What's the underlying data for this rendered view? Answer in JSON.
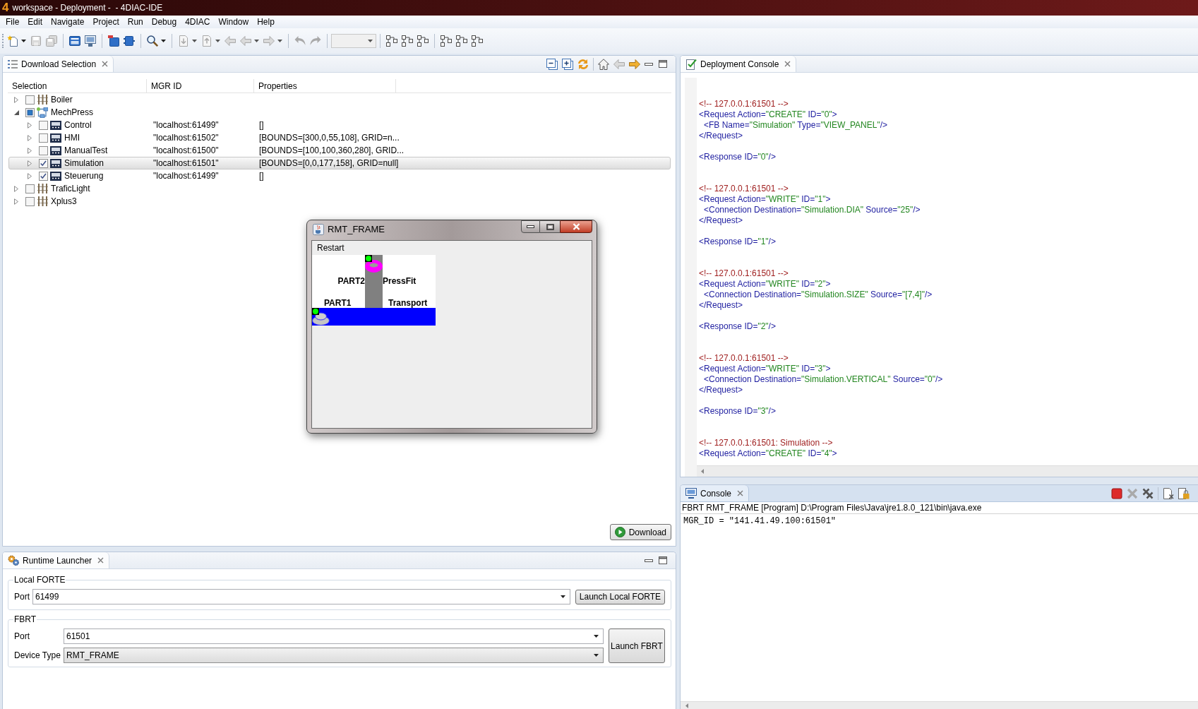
{
  "window": {
    "app_icon": "4",
    "title": "workspace - Deployment -  - 4DIAC-IDE"
  },
  "menu": [
    {
      "label": "File"
    },
    {
      "label": "Edit"
    },
    {
      "label": "Navigate"
    },
    {
      "label": "Project"
    },
    {
      "label": "Run"
    },
    {
      "label": "Debug"
    },
    {
      "label": "4DIAC"
    },
    {
      "label": "Window"
    },
    {
      "label": "Help"
    }
  ],
  "toolbar": {
    "groups": [
      [
        {
          "kind": "new",
          "disabled": false,
          "dropdown": true
        },
        {
          "kind": "save",
          "disabled": true,
          "dropdown": false
        },
        {
          "kind": "saveall",
          "disabled": true,
          "dropdown": false
        }
      ],
      [
        {
          "kind": "window",
          "disabled": false,
          "dropdown": false
        },
        {
          "kind": "monitor",
          "disabled": false,
          "dropdown": false
        }
      ],
      [
        {
          "kind": "blockmark",
          "disabled": false,
          "dropdown": false
        },
        {
          "kind": "block",
          "disabled": false,
          "dropdown": false
        }
      ],
      [
        {
          "kind": "search",
          "disabled": false,
          "dropdown": true
        }
      ],
      [
        {
          "kind": "pagedown",
          "disabled": true,
          "dropdown": true
        },
        {
          "kind": "pageup",
          "disabled": true,
          "dropdown": true
        },
        {
          "kind": "lastedit",
          "disabled": true,
          "dropdown": false
        },
        {
          "kind": "back",
          "disabled": true,
          "dropdown": true
        },
        {
          "kind": "forward",
          "disabled": true,
          "dropdown": true
        }
      ],
      [
        {
          "kind": "undo",
          "disabled": true,
          "dropdown": false
        },
        {
          "kind": "redo",
          "disabled": true,
          "dropdown": false
        }
      ],
      [
        {
          "kind": "combo",
          "disabled": true,
          "dropdown": true
        }
      ],
      [
        {
          "kind": "nodes",
          "disabled": false,
          "dropdown": false
        },
        {
          "kind": "nodes",
          "disabled": false,
          "dropdown": false
        },
        {
          "kind": "nodes",
          "disabled": false,
          "dropdown": false
        }
      ],
      [
        {
          "kind": "nodes",
          "disabled": false,
          "dropdown": false
        },
        {
          "kind": "nodes",
          "disabled": false,
          "dropdown": false
        },
        {
          "kind": "nodes",
          "disabled": false,
          "dropdown": false
        }
      ]
    ]
  },
  "download_selection": {
    "tab": {
      "label": "Download Selection",
      "active": false
    },
    "tools": [
      [
        {
          "kind": "collapseall",
          "disabled": false
        },
        {
          "kind": "expandall",
          "disabled": false
        },
        {
          "kind": "sync",
          "disabled": false
        }
      ],
      [
        {
          "kind": "home",
          "disabled": false
        },
        {
          "kind": "back",
          "disabled": true
        },
        {
          "kind": "forward",
          "disabled": false
        }
      ]
    ],
    "columns": [
      {
        "label": "Selection"
      },
      {
        "label": "MGR ID"
      },
      {
        "label": "Properties"
      }
    ],
    "items": [
      {
        "label": "Boiler",
        "kind": "system",
        "expanded": false,
        "checked": false,
        "partial": false,
        "selected": false
      },
      {
        "label": "MechPress",
        "kind": "system",
        "expanded": true,
        "checked": false,
        "partial": true,
        "selected": false,
        "children": [
          {
            "label": "Control",
            "kind": "device",
            "mgr_id": "\"localhost:61499\"",
            "properties": "[]",
            "expanded": false,
            "checked": false,
            "partial": false,
            "selected": false
          },
          {
            "label": "HMI",
            "kind": "device",
            "mgr_id": "\"localhost:61502\"",
            "properties": "[BOUNDS=[300,0,55,108], GRID=n...",
            "expanded": false,
            "checked": false,
            "partial": false,
            "selected": false
          },
          {
            "label": "ManualTest",
            "kind": "device",
            "mgr_id": "\"localhost:61500\"",
            "properties": "[BOUNDS=[100,100,360,280], GRID...",
            "expanded": false,
            "checked": false,
            "partial": false,
            "selected": false
          },
          {
            "label": "Simulation",
            "kind": "device",
            "mgr_id": "\"localhost:61501\"",
            "properties": "[BOUNDS=[0,0,177,158], GRID=null]",
            "expanded": false,
            "checked": true,
            "partial": false,
            "selected": true
          },
          {
            "label": "Steuerung",
            "kind": "device",
            "mgr_id": "\"localhost:61499\"",
            "properties": "[]",
            "expanded": false,
            "checked": true,
            "partial": false,
            "selected": false
          }
        ]
      },
      {
        "label": "TraficLight",
        "kind": "system",
        "expanded": false,
        "checked": false,
        "partial": false,
        "selected": false
      },
      {
        "label": "Xplus3",
        "kind": "system",
        "expanded": false,
        "checked": false,
        "partial": false,
        "selected": false
      }
    ],
    "download_button": {
      "label": "Download"
    }
  },
  "rmt_frame": {
    "title": "RMT_FRAME",
    "menu": [
      {
        "label": "Restart"
      }
    ],
    "simulation": {
      "upper_part_label": "PART2",
      "press_label": "PressFit",
      "lower_part_label": "PART1",
      "conveyor_label": "Transport",
      "sensors": [
        {
          "on": true
        },
        {
          "on": true
        }
      ]
    }
  },
  "runtime_launcher": {
    "tab": {
      "label": "Runtime Launcher",
      "active": false
    },
    "local_forte": {
      "title": "Local FORTE",
      "port": {
        "label": "Port",
        "value": "61499",
        "readonly": false
      },
      "launch_button": "Launch Local FORTE"
    },
    "fbrt": {
      "title": "FBRT",
      "port": {
        "label": "Port",
        "value": "61501",
        "readonly": false
      },
      "device_type": {
        "label": "Device Type",
        "value": "RMT_FRAME",
        "readonly": true
      },
      "launch_button": "Launch FBRT"
    }
  },
  "deployment_console": {
    "tab": {
      "label": "Deployment Console",
      "active": false
    },
    "entries": [
      {
        "comment": [
          {
            "kind": "comment",
            "text": "<!-- 127.0.0.1:61501 -->"
          }
        ],
        "request": {
          "open": [
            {
              "kind": "tag",
              "text": "<Request Action="
            },
            {
              "kind": "value",
              "text": "\"CREATE\""
            },
            {
              "kind": "tag",
              "text": " ID="
            },
            {
              "kind": "value",
              "text": "\"0\""
            },
            {
              "kind": "tag",
              "text": ">"
            }
          ],
          "children": [
            [
              {
                "kind": "tag",
                "text": "<FB Name="
              },
              {
                "kind": "value",
                "text": "\"Simulation\""
              },
              {
                "kind": "tag",
                "text": " Type="
              },
              {
                "kind": "value",
                "text": "\"VIEW_PANEL\""
              },
              {
                "kind": "tag",
                "text": "/>"
              }
            ]
          ],
          "close": [
            {
              "kind": "tag",
              "text": "</Request>"
            }
          ]
        },
        "response": [
          {
            "kind": "tag",
            "text": "<Response ID="
          },
          {
            "kind": "value",
            "text": "\"0\""
          },
          {
            "kind": "tag",
            "text": "/>"
          }
        ]
      },
      {
        "comment": [
          {
            "kind": "comment",
            "text": "<!-- 127.0.0.1:61501 -->"
          }
        ],
        "request": {
          "open": [
            {
              "kind": "tag",
              "text": "<Request Action="
            },
            {
              "kind": "value",
              "text": "\"WRITE\""
            },
            {
              "kind": "tag",
              "text": " ID="
            },
            {
              "kind": "value",
              "text": "\"1\""
            },
            {
              "kind": "tag",
              "text": ">"
            }
          ],
          "children": [
            [
              {
                "kind": "tag",
                "text": "<Connection Destination="
              },
              {
                "kind": "value",
                "text": "\"Simulation.DIA\""
              },
              {
                "kind": "tag",
                "text": " Source="
              },
              {
                "kind": "value",
                "text": "\"25\""
              },
              {
                "kind": "tag",
                "text": "/>"
              }
            ]
          ],
          "close": [
            {
              "kind": "tag",
              "text": "</Request>"
            }
          ]
        },
        "response": [
          {
            "kind": "tag",
            "text": "<Response ID="
          },
          {
            "kind": "value",
            "text": "\"1\""
          },
          {
            "kind": "tag",
            "text": "/>"
          }
        ]
      },
      {
        "comment": [
          {
            "kind": "comment",
            "text": "<!-- 127.0.0.1:61501 -->"
          }
        ],
        "request": {
          "open": [
            {
              "kind": "tag",
              "text": "<Request Action="
            },
            {
              "kind": "value",
              "text": "\"WRITE\""
            },
            {
              "kind": "tag",
              "text": " ID="
            },
            {
              "kind": "value",
              "text": "\"2\""
            },
            {
              "kind": "tag",
              "text": ">"
            }
          ],
          "children": [
            [
              {
                "kind": "tag",
                "text": "<Connection Destination="
              },
              {
                "kind": "value",
                "text": "\"Simulation.SIZE\""
              },
              {
                "kind": "tag",
                "text": " Source="
              },
              {
                "kind": "value",
                "text": "\"[7,4]\""
              },
              {
                "kind": "tag",
                "text": "/>"
              }
            ]
          ],
          "close": [
            {
              "kind": "tag",
              "text": "</Request>"
            }
          ]
        },
        "response": [
          {
            "kind": "tag",
            "text": "<Response ID="
          },
          {
            "kind": "value",
            "text": "\"2\""
          },
          {
            "kind": "tag",
            "text": "/>"
          }
        ]
      },
      {
        "comment": [
          {
            "kind": "comment",
            "text": "<!-- 127.0.0.1:61501 -->"
          }
        ],
        "request": {
          "open": [
            {
              "kind": "tag",
              "text": "<Request Action="
            },
            {
              "kind": "value",
              "text": "\"WRITE\""
            },
            {
              "kind": "tag",
              "text": " ID="
            },
            {
              "kind": "value",
              "text": "\"3\""
            },
            {
              "kind": "tag",
              "text": ">"
            }
          ],
          "children": [
            [
              {
                "kind": "tag",
                "text": "<Connection Destination="
              },
              {
                "kind": "value",
                "text": "\"Simulation.VERTICAL\""
              },
              {
                "kind": "tag",
                "text": " Source="
              },
              {
                "kind": "value",
                "text": "\"0\""
              },
              {
                "kind": "tag",
                "text": "/>"
              }
            ]
          ],
          "close": [
            {
              "kind": "tag",
              "text": "</Request>"
            }
          ]
        },
        "response": [
          {
            "kind": "tag",
            "text": "<Response ID="
          },
          {
            "kind": "value",
            "text": "\"3\""
          },
          {
            "kind": "tag",
            "text": "/>"
          }
        ]
      },
      {
        "comment": [
          {
            "kind": "comment",
            "text": "<!-- 127.0.0.1:61501: Simulation -->"
          }
        ],
        "request": {
          "open": [
            {
              "kind": "tag",
              "text": "<Request Action="
            },
            {
              "kind": "value",
              "text": "\"CREATE\""
            },
            {
              "kind": "tag",
              "text": " ID="
            },
            {
              "kind": "value",
              "text": "\"4\""
            },
            {
              "kind": "tag",
              "text": ">"
            }
          ]
        }
      }
    ]
  },
  "console": {
    "tab": {
      "label": "Console",
      "active": true
    },
    "tools": [
      [
        {
          "kind": "stop",
          "disabled": false
        },
        {
          "kind": "remove",
          "disabled": true
        },
        {
          "kind": "removeall",
          "disabled": false
        }
      ],
      [
        {
          "kind": "clear",
          "disabled": false
        },
        {
          "kind": "lock",
          "disabled": false
        }
      ]
    ],
    "process": "FBRT RMT_FRAME [Program] D:\\Program Files\\Java\\jre1.8.0_121\\bin\\java.exe",
    "output": [
      "MGR_ID = \"141.41.49.100:61501\""
    ]
  }
}
